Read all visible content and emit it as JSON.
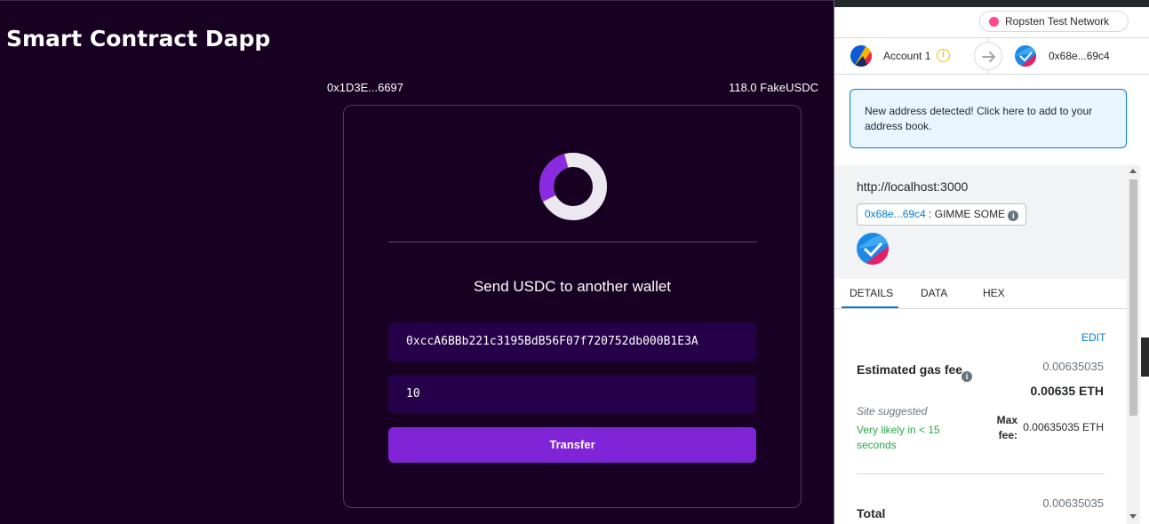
{
  "dapp": {
    "title": "Smart Contract Dapp",
    "wallet_address": "0x1D3E...6697",
    "balance": "118.0 FakeUSDC",
    "send_title": "Send USDC to another wallet",
    "recipient_value": "0xccA6BBb221c3195BdB56F07f720752db000B1E3A",
    "amount_value": "10",
    "transfer_label": "Transfer",
    "colors": {
      "background": "#180022",
      "input": "#260048",
      "accent": "#7f24d7"
    }
  },
  "metamask": {
    "network": "Ropsten Test Network",
    "from_account": "Account 1",
    "to_account": "0x68e...69c4",
    "alert": "New address detected! Click here to add to your address book.",
    "origin": "http://localhost:3000",
    "method_address": "0x68e...69c4",
    "method_separator": " : ",
    "method_name": "GIMME SOME",
    "tabs": [
      "DETAILS",
      "DATA",
      "HEX"
    ],
    "edit_label": "EDIT",
    "gas_label": "Estimated gas fee",
    "gas_value": "0.00635035",
    "gas_value_bold": "0.00635 ETH",
    "site_suggested": "Site suggested",
    "likelihood": "Very likely in < 15 seconds",
    "max_fee_label": "Max fee:",
    "max_fee_value": "0.00635035 ETH",
    "total_value": "0.00635035",
    "total_label": "Total",
    "info_glyph": "i",
    "colors": {
      "link": "#037dd6",
      "success": "#28a745",
      "network_dot": "#ff4a8d"
    }
  }
}
